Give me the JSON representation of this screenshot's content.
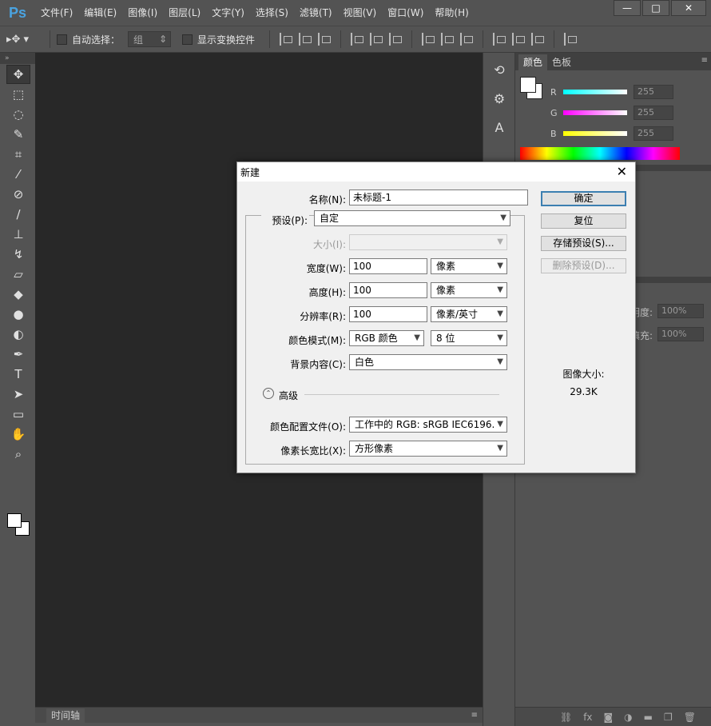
{
  "app": {
    "logo": "Ps"
  },
  "menu": [
    "文件(F)",
    "编辑(E)",
    "图像(I)",
    "图层(L)",
    "文字(Y)",
    "选择(S)",
    "滤镜(T)",
    "视图(V)",
    "窗口(W)",
    "帮助(H)"
  ],
  "window_controls": {
    "minimize": "—",
    "maximize": "□",
    "close": "✕"
  },
  "options": {
    "auto_select_label": "自动选择：",
    "auto_select_value": "组",
    "show_transform_label": "显示变换控件"
  },
  "timeline": {
    "tab": "时间轴"
  },
  "color_panel": {
    "tabs": [
      "颜色",
      "色板"
    ],
    "r_label": "R",
    "g_label": "G",
    "b_label": "B",
    "r_value": "255",
    "g_value": "255",
    "b_value": "255"
  },
  "layers_panel": {
    "opacity_label": "明度:",
    "opacity_value": "100%",
    "fill_label": "填充:",
    "fill_value": "100%"
  },
  "dialog": {
    "title": "新建",
    "close": "✕",
    "name_label": "名称(N):",
    "name_value": "未标题-1",
    "preset_label": "预设(P):",
    "preset_value": "自定",
    "size_label": "大小(I):",
    "width_label": "宽度(W):",
    "width_value": "100",
    "width_unit": "像素",
    "height_label": "高度(H):",
    "height_value": "100",
    "height_unit": "像素",
    "resolution_label": "分辨率(R):",
    "resolution_value": "100",
    "resolution_unit": "像素/英寸",
    "color_mode_label": "颜色模式(M):",
    "color_mode_value": "RGB 颜色",
    "bit_depth_value": "8 位",
    "background_label": "背景内容(C):",
    "background_value": "白色",
    "advanced_label": "高级",
    "color_profile_label": "颜色配置文件(O):",
    "color_profile_value": "工作中的 RGB: sRGB IEC6196...",
    "pixel_aspect_label": "像素长宽比(X):",
    "pixel_aspect_value": "方形像素",
    "ok_button": "确定",
    "reset_button": "复位",
    "save_preset_button": "存储预设(S)...",
    "delete_preset_button": "删除预设(D)...",
    "image_size_label": "图像大小:",
    "image_size_value": "29.3K"
  }
}
